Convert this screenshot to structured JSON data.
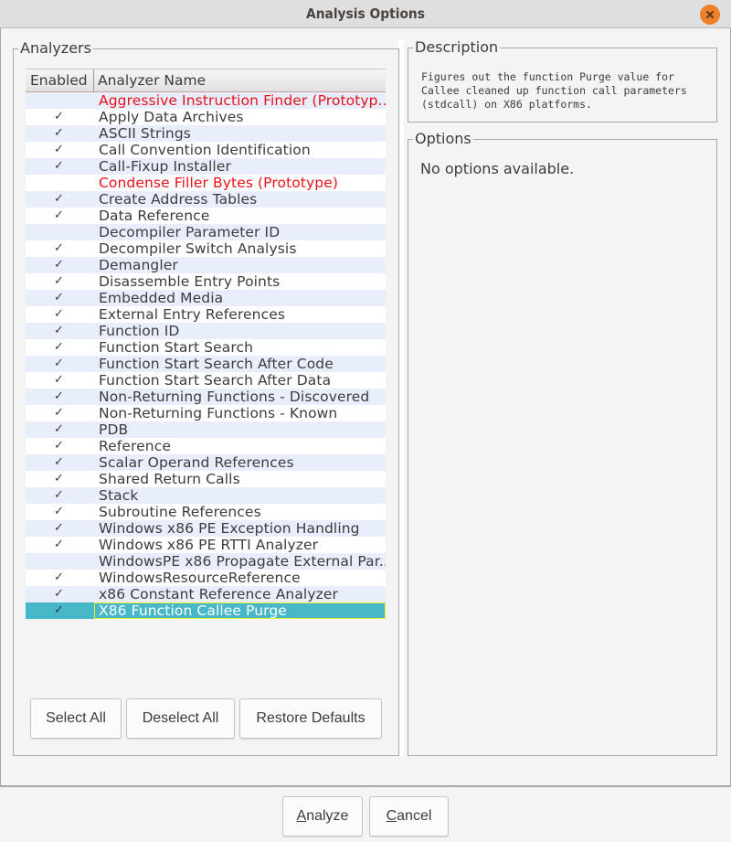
{
  "window": {
    "title": "Analysis Options",
    "close_icon": "close-icon",
    "accent_color": "#f08028"
  },
  "analyzers": {
    "group_label": "Analyzers",
    "columns": {
      "enabled": "Enabled",
      "name": "Analyzer Name"
    },
    "check_glyph": "✓",
    "rows": [
      {
        "enabled": false,
        "name": "Aggressive Instruction Finder (Prototyp...",
        "prototype": true
      },
      {
        "enabled": true,
        "name": "Apply Data Archives",
        "prototype": false
      },
      {
        "enabled": true,
        "name": "ASCII Strings",
        "prototype": false
      },
      {
        "enabled": true,
        "name": "Call Convention Identification",
        "prototype": false
      },
      {
        "enabled": true,
        "name": "Call-Fixup Installer",
        "prototype": false
      },
      {
        "enabled": false,
        "name": "Condense Filler Bytes (Prototype)",
        "prototype": true
      },
      {
        "enabled": true,
        "name": "Create Address Tables",
        "prototype": false
      },
      {
        "enabled": true,
        "name": "Data Reference",
        "prototype": false
      },
      {
        "enabled": false,
        "name": "Decompiler Parameter ID",
        "prototype": false
      },
      {
        "enabled": true,
        "name": "Decompiler Switch Analysis",
        "prototype": false
      },
      {
        "enabled": true,
        "name": "Demangler",
        "prototype": false
      },
      {
        "enabled": true,
        "name": "Disassemble Entry Points",
        "prototype": false
      },
      {
        "enabled": true,
        "name": "Embedded Media",
        "prototype": false
      },
      {
        "enabled": true,
        "name": "External Entry References",
        "prototype": false
      },
      {
        "enabled": true,
        "name": "Function ID",
        "prototype": false
      },
      {
        "enabled": true,
        "name": "Function Start Search",
        "prototype": false
      },
      {
        "enabled": true,
        "name": "Function Start Search After Code",
        "prototype": false
      },
      {
        "enabled": true,
        "name": "Function Start Search After Data",
        "prototype": false
      },
      {
        "enabled": true,
        "name": "Non-Returning Functions - Discovered",
        "prototype": false
      },
      {
        "enabled": true,
        "name": "Non-Returning Functions - Known",
        "prototype": false
      },
      {
        "enabled": true,
        "name": "PDB",
        "prototype": false
      },
      {
        "enabled": true,
        "name": "Reference",
        "prototype": false
      },
      {
        "enabled": true,
        "name": "Scalar Operand References",
        "prototype": false
      },
      {
        "enabled": true,
        "name": "Shared Return Calls",
        "prototype": false
      },
      {
        "enabled": true,
        "name": "Stack",
        "prototype": false
      },
      {
        "enabled": true,
        "name": "Subroutine References",
        "prototype": false
      },
      {
        "enabled": true,
        "name": "Windows x86 PE Exception Handling",
        "prototype": false
      },
      {
        "enabled": true,
        "name": "Windows x86 PE RTTI Analyzer",
        "prototype": false
      },
      {
        "enabled": false,
        "name": "WindowsPE x86 Propagate External Par...",
        "prototype": false
      },
      {
        "enabled": true,
        "name": "WindowsResourceReference",
        "prototype": false
      },
      {
        "enabled": true,
        "name": "x86 Constant Reference Analyzer",
        "prototype": false
      },
      {
        "enabled": true,
        "name": "X86 Function Callee Purge",
        "prototype": false,
        "selected": true
      }
    ],
    "buttons": {
      "select_all": "Select All",
      "deselect_all": "Deselect All",
      "restore_defaults": "Restore Defaults"
    }
  },
  "description": {
    "group_label": "Description",
    "text": "Figures out the function Purge value for\nCallee cleaned up function call parameters\n(stdcall) on X86 platforms."
  },
  "options": {
    "group_label": "Options",
    "text": "No options available."
  },
  "footer": {
    "analyze": {
      "mnemonic": "A",
      "rest": "nalyze"
    },
    "cancel": {
      "mnemonic": "C",
      "rest": "ancel"
    }
  }
}
